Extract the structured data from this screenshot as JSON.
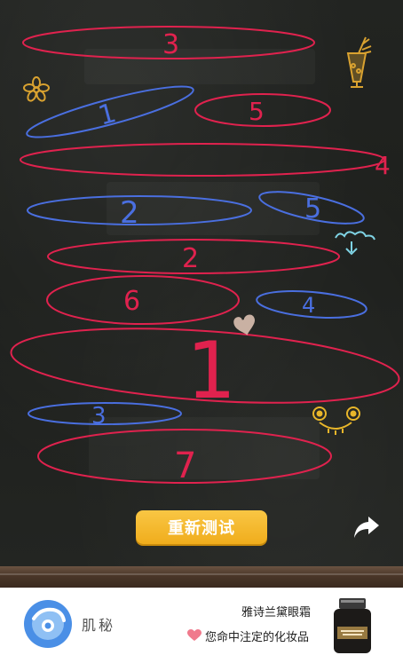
{
  "board": {
    "ovals": [
      {
        "label": "3",
        "color": "#e0224e"
      },
      {
        "label": "1",
        "color": "#4a6fe0"
      },
      {
        "label": "5",
        "color": "#e0224e"
      },
      {
        "label": "4",
        "color": "#e0224e"
      },
      {
        "label": "2",
        "color": "#4a6fe0"
      },
      {
        "label": "5",
        "color": "#4a6fe0"
      },
      {
        "label": "2",
        "color": "#e0224e"
      },
      {
        "label": "6",
        "color": "#e0224e"
      },
      {
        "label": "4",
        "color": "#4a6fe0"
      },
      {
        "label": "1",
        "color": "#e0224e"
      },
      {
        "label": "3",
        "color": "#4a6fe0"
      },
      {
        "label": "7",
        "color": "#e0224e"
      }
    ],
    "decorations": [
      "flower-icon",
      "drink-icon",
      "cloud-icon",
      "heart-icon",
      "smiley-face-icon"
    ]
  },
  "actions": {
    "retest_label": "重新测试",
    "share_icon": "share-arrow-icon"
  },
  "ad": {
    "brand": "肌秘",
    "title": "雅诗兰黛眼霜",
    "slogan": "您命中注定的化妆品",
    "heart_color": "#f07a8c",
    "logo_color": "#4a8fe6"
  }
}
